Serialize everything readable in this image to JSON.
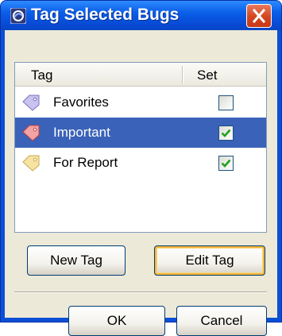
{
  "window": {
    "title": "Tag Selected Bugs"
  },
  "table": {
    "columns": [
      "Tag",
      "Set"
    ],
    "rows": [
      {
        "label": "Favorites",
        "checked": false,
        "selected": false,
        "icon": "tag-icon-purple"
      },
      {
        "label": "Important",
        "checked": true,
        "selected": true,
        "icon": "tag-icon-red"
      },
      {
        "label": "For Report",
        "checked": true,
        "selected": false,
        "icon": "tag-icon-yellow"
      }
    ]
  },
  "buttons": {
    "new_tag": "New Tag",
    "edit_tag": "Edit Tag",
    "ok": "OK",
    "cancel": "Cancel"
  },
  "colors": {
    "titlebar": "#0a5ee8",
    "selection": "#3a62b8",
    "check": "#21a121"
  }
}
